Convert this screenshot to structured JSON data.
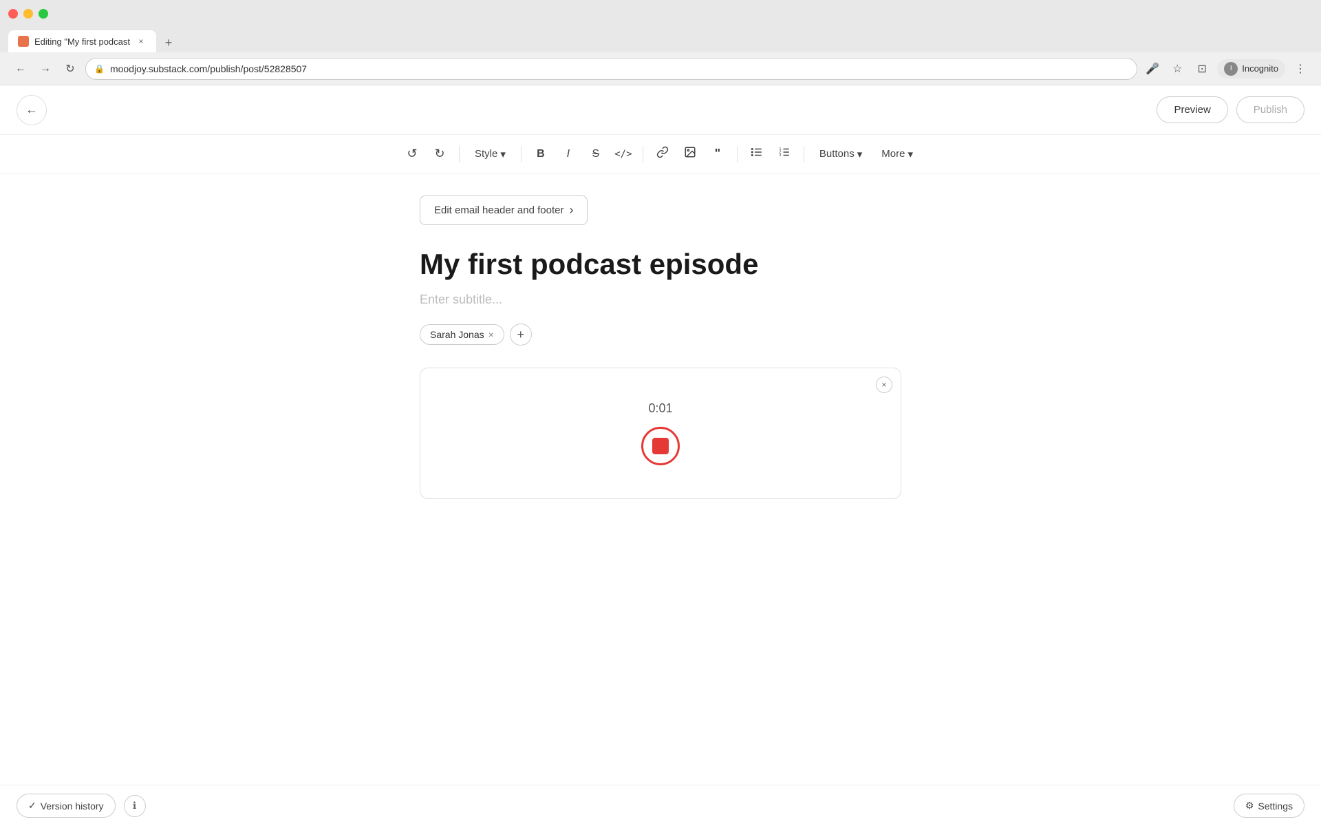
{
  "browser": {
    "traffic_lights": [
      "red",
      "yellow",
      "green"
    ],
    "tab": {
      "title": "Editing \"My first podcast",
      "favicon": "📋",
      "close_label": "×"
    },
    "new_tab_label": "+",
    "address": "moodjoy.substack.com/publish/post/52828507",
    "nav": {
      "back_label": "←",
      "forward_label": "→",
      "reload_label": "↻",
      "mic_icon": "🎤",
      "star_icon": "☆",
      "sidebar_icon": "⊡",
      "profile": "Incognito",
      "more_icon": "⋮"
    }
  },
  "toolbar": {
    "undo_label": "↺",
    "redo_label": "↻",
    "style_label": "Style",
    "bold_label": "B",
    "italic_label": "I",
    "strikethrough_label": "S̶",
    "code_label": "</>",
    "link_label": "🔗",
    "image_label": "🖼",
    "quote_label": "❝❞",
    "bullet_list_label": "≡",
    "ordered_list_label": "≣",
    "buttons_label": "Buttons",
    "more_label": "More",
    "dropdown_arrow": "▾"
  },
  "action_bar": {
    "back_label": "←",
    "preview_label": "Preview",
    "publish_label": "Publish"
  },
  "editor": {
    "edit_header_btn": "Edit email header and footer",
    "edit_header_arrow": "›",
    "post_title": "My first podcast episode",
    "subtitle_placeholder": "Enter subtitle...",
    "author": {
      "name": "Sarah Jonas",
      "remove_label": "×"
    },
    "add_author_label": "+",
    "audio": {
      "timer": "0:01",
      "close_label": "×"
    }
  },
  "bottom_bar": {
    "version_history_check": "✓",
    "version_history_label": "Version history",
    "info_label": "ℹ",
    "settings_gear": "⚙",
    "settings_label": "Settings"
  },
  "colors": {
    "accent_red": "#e53935",
    "border": "#e0e0e0",
    "text_primary": "#1a1a1a",
    "text_secondary": "#555",
    "text_placeholder": "#bbb"
  }
}
